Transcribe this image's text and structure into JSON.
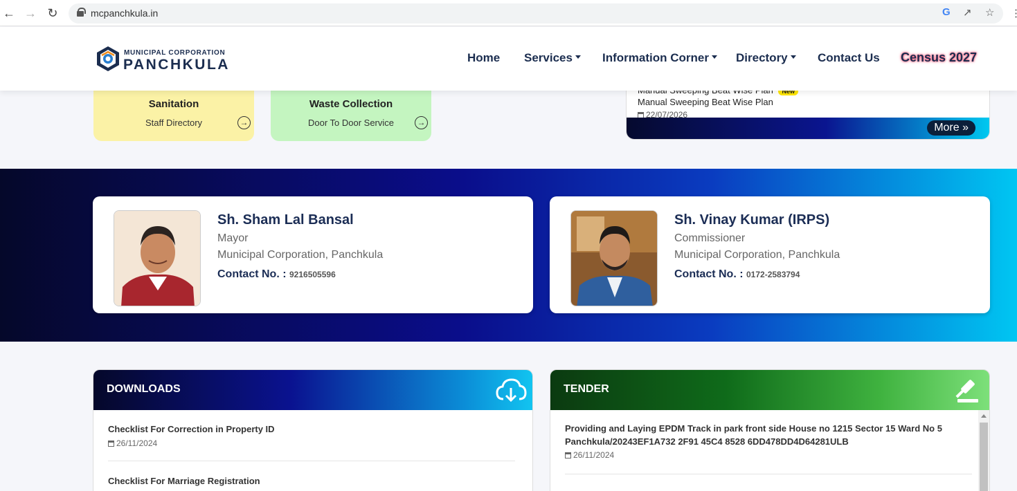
{
  "browser": {
    "url": "mcpanchkula.in"
  },
  "header": {
    "logo_small": "MUNICIPAL CORPORATION",
    "logo_big": "PANCHKULA",
    "nav": {
      "home": "Home",
      "services": "Services",
      "information_corner": "Information Corner",
      "directory": "Directory",
      "contact_us": "Contact Us",
      "census": "Census 2027"
    }
  },
  "quick_cards": [
    {
      "title": "Sanitation",
      "subtitle": "Staff Directory",
      "color": "#fbf2a6"
    },
    {
      "title": "Waste Collection",
      "subtitle": "Door To Door Service",
      "color": "#c4f5c0"
    }
  ],
  "notice": {
    "cut_title": "Manual Sweeping Beat Wise Plan",
    "badge": "New",
    "title": "Manual Sweeping Beat Wise Plan",
    "date": "22/07/2026",
    "more_label": "More"
  },
  "officials": [
    {
      "name": "Sh. Sham Lal Bansal",
      "role": "Mayor",
      "org": "Municipal Corporation, Panchkula",
      "contact_label": "Contact No. :",
      "contact_number": "9216505596"
    },
    {
      "name": "Sh. Vinay Kumar (IRPS)",
      "role": "Commissioner",
      "org": "Municipal Corporation, Panchkula",
      "contact_label": "Contact No. :",
      "contact_number": "0172-2583794"
    }
  ],
  "downloads": {
    "title": "DOWNLOADS",
    "items": [
      {
        "title": "Checklist For Correction in Property ID",
        "date": "26/11/2024"
      },
      {
        "title": "Checklist For Marriage Registration"
      }
    ]
  },
  "tender": {
    "title": "TENDER",
    "items": [
      {
        "title_line1": "Providing and Laying EPDM Track in park front side House no 1215 Sector 15 Ward No 5",
        "title_line2": "Panchkula/20243EF1A732 2F91 45C4 8528 6DD478DD4D64281ULB",
        "date": "26/11/2024"
      }
    ]
  },
  "colors": {
    "brand_navy": "#1b2d4f",
    "accent_cyan": "#00c6f2",
    "tender_green": "#0f6b1a"
  }
}
